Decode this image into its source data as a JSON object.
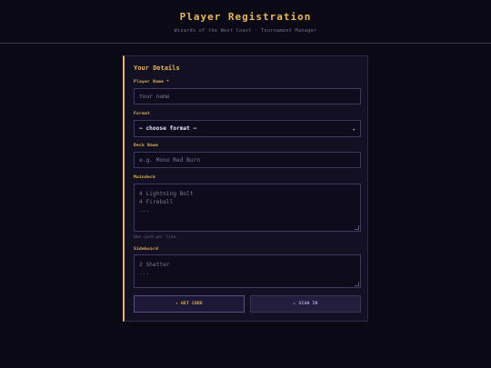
{
  "header": {
    "title": "Player Registration",
    "subtitle": "Wizards of the West Coast · Tournament Manager"
  },
  "form": {
    "section_title": "Your Details",
    "player_name": {
      "label": "Player Name *",
      "placeholder": "Your name"
    },
    "format": {
      "label": "Format",
      "value": "— choose format —"
    },
    "deck_name": {
      "label": "Deck Name",
      "placeholder": "e.g. Mono Red Burn"
    },
    "maindeck": {
      "label": "Maindeck",
      "placeholder_lines": [
        "4 Lightning Bolt",
        "4 Fireball",
        "..."
      ],
      "hint": "One card per line."
    },
    "sideboard": {
      "label": "Sideboard",
      "placeholder_lines": [
        "2 Shatter",
        "..."
      ]
    },
    "buttons": {
      "get_code": "✦ GET CODE",
      "sign_in": "↓ SIGN IN"
    }
  },
  "colors": {
    "accent": "#e8b85a",
    "background": "#0b0916",
    "card": "#121022"
  }
}
